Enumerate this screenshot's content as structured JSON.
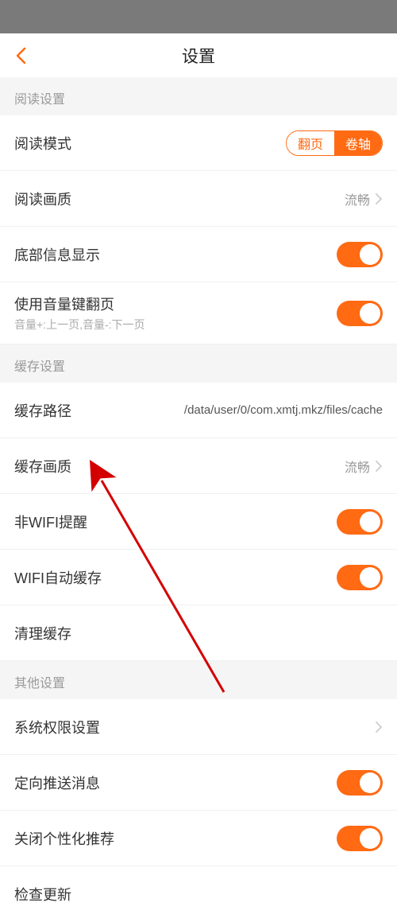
{
  "nav": {
    "title": "设置"
  },
  "sections": {
    "reading": {
      "header": "阅读设置",
      "mode": {
        "label": "阅读模式",
        "opt1": "翻页",
        "opt2": "卷轴"
      },
      "quality": {
        "label": "阅读画质",
        "value": "流畅"
      },
      "bottomInfo": {
        "label": "底部信息显示"
      },
      "volumeFlip": {
        "label": "使用音量键翻页",
        "sub": "音量+:上一页,音量-:下一页"
      }
    },
    "cache": {
      "header": "缓存设置",
      "path": {
        "label": "缓存路径",
        "value": "/data/user/0/com.xmtj.mkz/files/cache"
      },
      "quality": {
        "label": "缓存画质",
        "value": "流畅"
      },
      "nonWifi": {
        "label": "非WIFI提醒"
      },
      "wifiAuto": {
        "label": "WIFI自动缓存"
      },
      "clear": {
        "label": "清理缓存"
      }
    },
    "other": {
      "header": "其他设置",
      "perm": {
        "label": "系统权限设置"
      },
      "push": {
        "label": "定向推送消息"
      },
      "personal": {
        "label": "关闭个性化推荐"
      },
      "update": {
        "label": "检查更新"
      }
    }
  }
}
